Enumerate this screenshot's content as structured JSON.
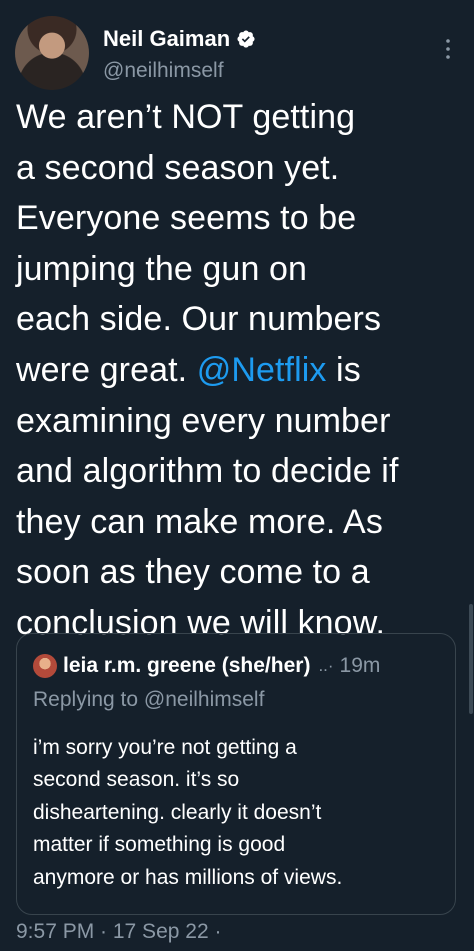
{
  "author": {
    "display_name": "Neil Gaiman",
    "handle": "@neilhimself",
    "verified": true,
    "avatar_icon": "profile-photo"
  },
  "tweet": {
    "text_before_mention": "We aren’t NOT getting\na second season yet.\nEveryone seems to be\njumping the gun on\neach side.  Our numbers\nwere great. ",
    "mention": "@Netflix",
    "text_after_mention": " is\nexamining every number\nand algorithm to decide if\nthey can make more. As\nsoon as they come to a\nconclusion we will know."
  },
  "quoted_tweet": {
    "author_name": "leia r.m. greene (she/her)",
    "separator": "..·",
    "time": "19m",
    "replying_to": "Replying to @neilhimself",
    "text": "i’m sorry you’re not getting a\nsecond season. it’s so\ndisheartening. clearly it doesn’t\nmatter if something is good\nanymore or has millions of views."
  },
  "footer": {
    "timestamp": "9:57 PM · 17 Sep 22 ·"
  },
  "colors": {
    "background": "#15202b",
    "text": "#ffffff",
    "secondary_text": "#8b98a5",
    "accent": "#1d9bf0",
    "border": "#38444d"
  }
}
